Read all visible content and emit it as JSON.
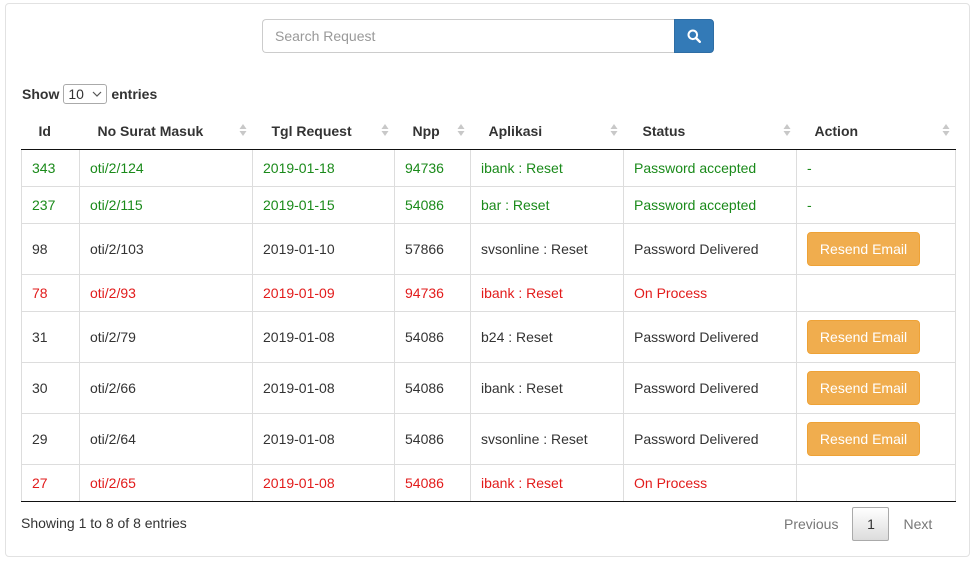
{
  "search": {
    "placeholder": "Search Request",
    "value": ""
  },
  "length_control": {
    "show_label": "Show",
    "selected": "10",
    "entries_label": "entries"
  },
  "table": {
    "columns": [
      "Id",
      "No Surat Masuk",
      "Tgl Request",
      "Npp",
      "Aplikasi",
      "Status",
      "Action"
    ],
    "rows": [
      {
        "id": "343",
        "no_surat": "oti/2/124",
        "tgl": "2019-01-18",
        "npp": "94736",
        "aplikasi": "ibank : Reset",
        "status": "Password accepted",
        "action": "-"
      },
      {
        "id": "237",
        "no_surat": "oti/2/115",
        "tgl": "2019-01-15",
        "npp": "54086",
        "aplikasi": "bar : Reset",
        "status": "Password accepted",
        "action": "-"
      },
      {
        "id": "98",
        "no_surat": "oti/2/103",
        "tgl": "2019-01-10",
        "npp": "57866",
        "aplikasi": "svsonline : Reset",
        "status": "Password Delivered",
        "action": "Resend Email"
      },
      {
        "id": "78",
        "no_surat": "oti/2/93",
        "tgl": "2019-01-09",
        "npp": "94736",
        "aplikasi": "ibank : Reset",
        "status": "On Process",
        "action": ""
      },
      {
        "id": "31",
        "no_surat": "oti/2/79",
        "tgl": "2019-01-08",
        "npp": "54086",
        "aplikasi": "b24 : Reset",
        "status": "Password Delivered",
        "action": "Resend Email"
      },
      {
        "id": "30",
        "no_surat": "oti/2/66",
        "tgl": "2019-01-08",
        "npp": "54086",
        "aplikasi": "ibank : Reset",
        "status": "Password Delivered",
        "action": "Resend Email"
      },
      {
        "id": "29",
        "no_surat": "oti/2/64",
        "tgl": "2019-01-08",
        "npp": "54086",
        "aplikasi": "svsonline : Reset",
        "status": "Password Delivered",
        "action": "Resend Email"
      },
      {
        "id": "27",
        "no_surat": "oti/2/65",
        "tgl": "2019-01-08",
        "npp": "54086",
        "aplikasi": "ibank : Reset",
        "status": "On Process",
        "action": ""
      }
    ]
  },
  "info": "Showing 1 to 8 of 8 entries",
  "pagination": {
    "previous": "Previous",
    "current": "1",
    "next": "Next"
  },
  "colors": {
    "accepted": "#1a8a1a",
    "on_process": "#e21b1b",
    "primary": "#337ab7",
    "warning": "#f0ad4e"
  },
  "icons": {
    "search": "search-icon",
    "select": "chevron-down-icon",
    "sort": "sort-both-icon"
  }
}
